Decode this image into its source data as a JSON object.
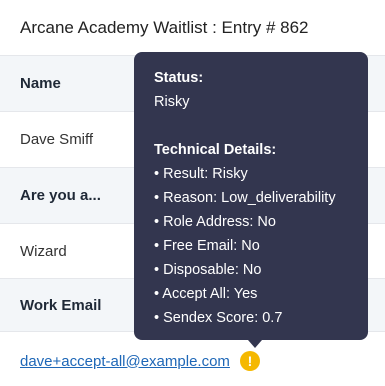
{
  "header": {
    "title": "Arcane Academy Waitlist : Entry # 862"
  },
  "fields": [
    {
      "label": "Name",
      "value": "Dave Smiff"
    },
    {
      "label": "Are you a...",
      "value": "Wizard"
    },
    {
      "label": "Work Email",
      "value": "dave+accept-all@example.com"
    }
  ],
  "status_icon": {
    "symbol": "!",
    "color": "#f5b800",
    "icon": "warning-icon"
  },
  "tooltip": {
    "status_heading": "Status:",
    "status_value": "Risky",
    "details_heading": "Technical Details:",
    "details": [
      "• Result: Risky",
      "• Reason: Low_deliverability",
      "• Role Address: No",
      "• Free Email: No",
      "• Disposable: No",
      "• Accept All: Yes",
      "• Sendex Score: 0.7"
    ]
  }
}
